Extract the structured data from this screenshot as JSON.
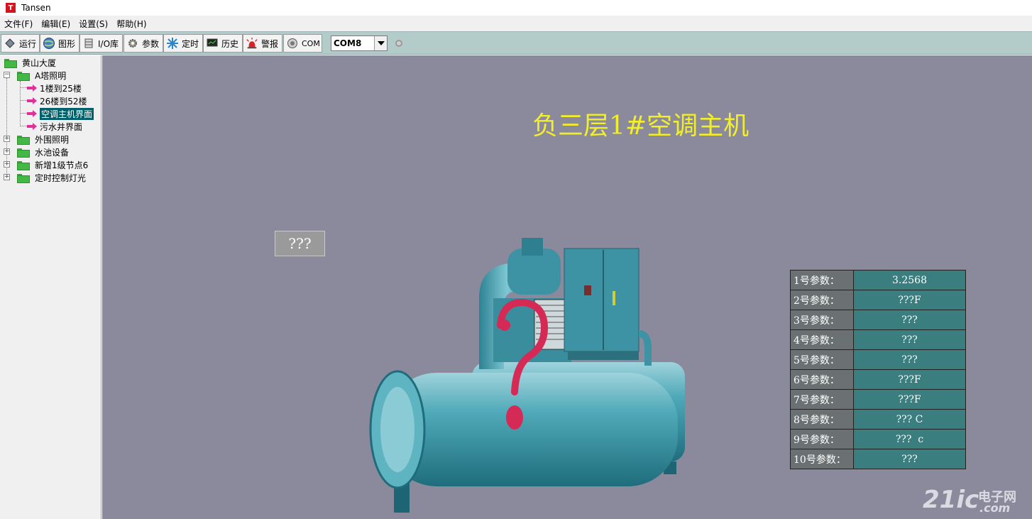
{
  "window": {
    "title": "Tansen",
    "icon_letter": "T"
  },
  "menu": [
    "文件(F)",
    "编辑(E)",
    "设置(S)",
    "帮助(H)"
  ],
  "toolbar": {
    "buttons": [
      {
        "label": "运行",
        "icon": "run-icon"
      },
      {
        "label": "图形",
        "icon": "globe-icon"
      },
      {
        "label": "I/O库",
        "icon": "database-icon"
      },
      {
        "label": "参数",
        "icon": "gear-icon"
      },
      {
        "label": "定时",
        "icon": "snowflake-icon"
      },
      {
        "label": "历史",
        "icon": "screen-icon"
      },
      {
        "label": "警报",
        "icon": "alarm-icon"
      },
      {
        "label": "COM",
        "icon": "com-icon"
      }
    ],
    "com_port": "COM8"
  },
  "tree": {
    "root": "黄山大厦",
    "group_a": "A塔照明",
    "children": [
      "1楼到25楼",
      "26楼到52楼",
      "空调主机界面",
      "污水井界面"
    ],
    "selected": "空调主机界面",
    "others": [
      "外围照明",
      "水池设备",
      "新增1级节点6",
      "定时控制灯光"
    ]
  },
  "main": {
    "heading": "负三层1#空调主机",
    "unknown_box": "???",
    "params": [
      {
        "label": "1号参数：",
        "value": "3.2568"
      },
      {
        "label": "2号参数：",
        "value": "???F"
      },
      {
        "label": "3号参数：",
        "value": "???"
      },
      {
        "label": "4号参数：",
        "value": "???"
      },
      {
        "label": "5号参数：",
        "value": "???"
      },
      {
        "label": "6号参数：",
        "value": "???F"
      },
      {
        "label": "7号参数：",
        "value": "???F"
      },
      {
        "label": "8号参数：",
        "value": "??? C"
      },
      {
        "label": "9号参数：",
        "value": "???  c"
      },
      {
        "label": "10号参数：",
        "value": "???"
      }
    ]
  },
  "watermark": {
    "main": "21ic",
    "cn": "电子网",
    "domain": ".com"
  },
  "colors": {
    "canvas": "#8b8a9c",
    "heading": "#f2ef2a",
    "selected": "#005f68",
    "table_value": "#3a7e80"
  }
}
